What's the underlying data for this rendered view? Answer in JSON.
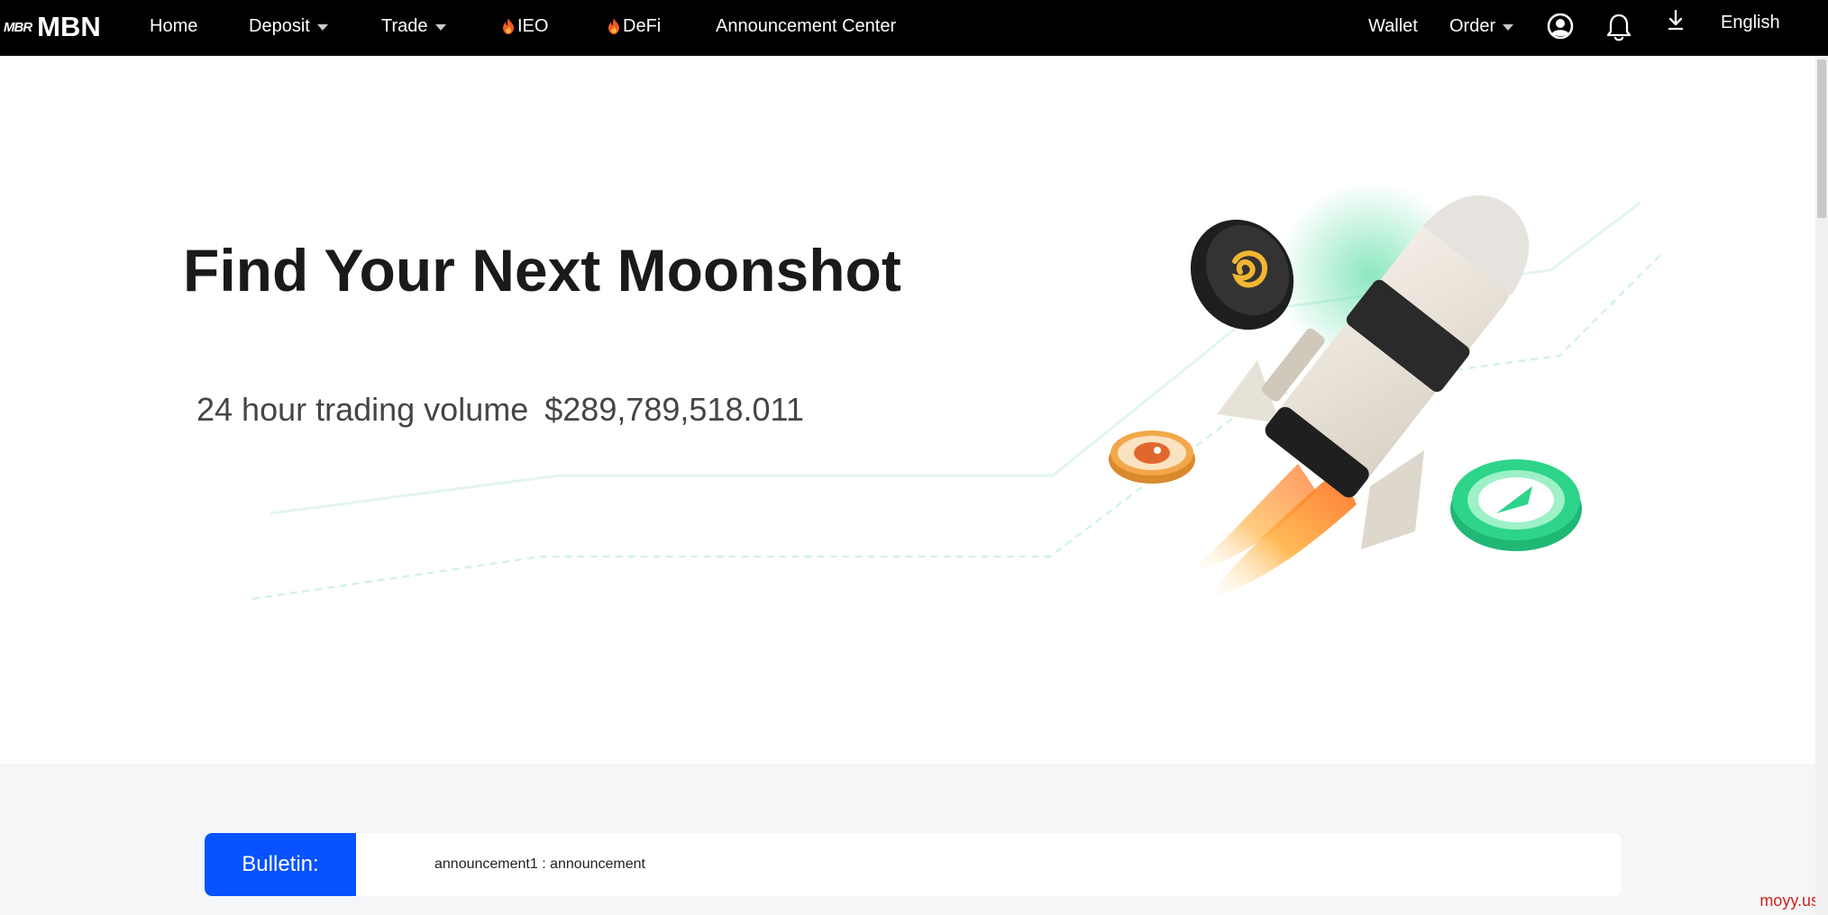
{
  "brand": {
    "mark": "MBR",
    "name": "MBN"
  },
  "nav": {
    "home": "Home",
    "deposit": "Deposit",
    "trade": "Trade",
    "ieo": "IEO",
    "defi": "DeFi",
    "announcement_center": "Announcement Center",
    "wallet": "Wallet",
    "order": "Order",
    "language": "English"
  },
  "icons": {
    "account": "user-circle-icon",
    "notifications": "bell-icon",
    "download": "download-icon",
    "fire": "fire-icon",
    "dropdown": "caret-down-icon"
  },
  "hero": {
    "title": "Find Your Next Moonshot",
    "volume_label": "24 hour trading volume",
    "volume_value": "$289,789,518.011"
  },
  "bulletin": {
    "tag": "Bulletin:",
    "text": "announcement1 : announcement"
  },
  "watermark": "moyy.us",
  "colors": {
    "nav_bg": "#000000",
    "bulletin_accent": "#0852ff",
    "coin_green": "#2dd48a",
    "coin_orange": "#f2a84a",
    "watermark": "#d21f1f"
  }
}
